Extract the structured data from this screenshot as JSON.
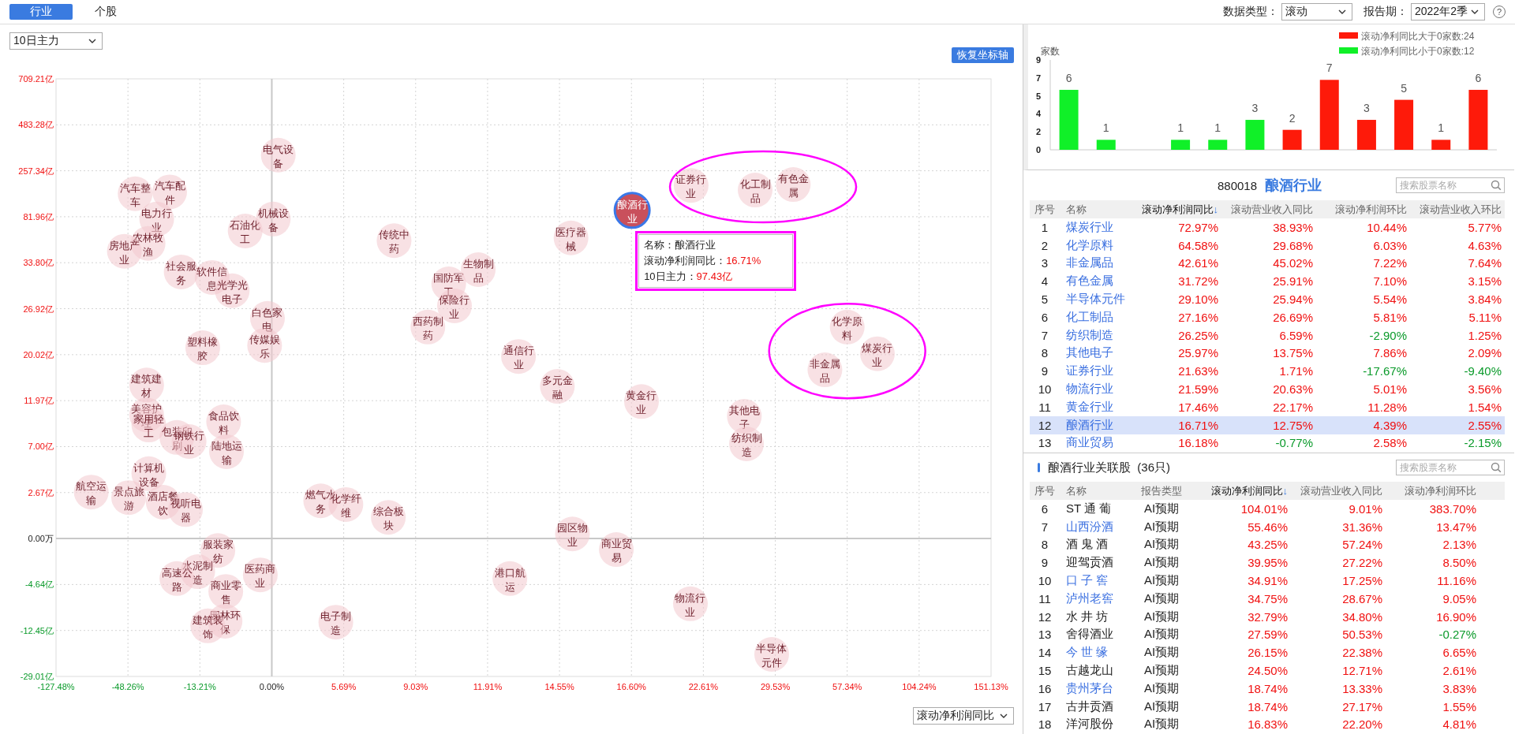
{
  "top_bar": {
    "tabs": [
      {
        "label": "行业",
        "selected": true
      },
      {
        "label": "个股",
        "selected": false
      }
    ],
    "filters": [
      {
        "label": "数据类型：",
        "value": "滚动"
      },
      {
        "label": "报告期：",
        "value": "2022年2季"
      }
    ],
    "help": "?"
  },
  "scatter": {
    "metric_select": "10日主力",
    "reset_button": "恢复坐标轴",
    "axis_select": "滚动净利润同比",
    "x_tick_labels": [
      "-127.48%",
      "-48.26%",
      "-13.21%",
      "0.00%",
      "5.69%",
      "9.03%",
      "11.91%",
      "14.55%",
      "16.60%",
      "22.61%",
      "29.53%",
      "57.34%",
      "104.24%",
      "151.13%"
    ],
    "y_tick_labels": [
      "709.21亿",
      "483.28亿",
      "257.34亿",
      "81.96亿",
      "33.80亿",
      "26.92亿",
      "20.02亿",
      "11.97亿",
      "7.00亿",
      "2.67亿",
      "0.00万",
      "-4.64亿",
      "-12.45亿",
      "-29.01亿"
    ],
    "bubbles": [
      {
        "label": "电气设备",
        "selected": false
      },
      {
        "label": "汽车整车",
        "selected": false
      },
      {
        "label": "汽车配件",
        "selected": false
      },
      {
        "label": "电力行业",
        "selected": false
      },
      {
        "label": "农林牧渔",
        "selected": false
      },
      {
        "label": "房地产业",
        "selected": false
      },
      {
        "label": "石油化工",
        "selected": false
      },
      {
        "label": "机械设备",
        "selected": false
      },
      {
        "label": "传统中药",
        "selected": false
      },
      {
        "label": "社会服务",
        "selected": false
      },
      {
        "label": "软件信息",
        "selected": false
      },
      {
        "label": "光学光电子",
        "selected": false
      },
      {
        "label": "白色家电",
        "selected": false
      },
      {
        "label": "塑料橡胶",
        "selected": false
      },
      {
        "label": "传媒娱乐",
        "selected": false
      },
      {
        "label": "国防军工",
        "selected": false
      },
      {
        "label": "生物制品",
        "selected": false
      },
      {
        "label": "保险行业",
        "selected": false
      },
      {
        "label": "西药制药",
        "selected": false
      },
      {
        "label": "通信行业",
        "selected": false
      },
      {
        "label": "建筑建材",
        "selected": false
      },
      {
        "label": "美容护理",
        "selected": false
      },
      {
        "label": "家用轻工",
        "selected": false
      },
      {
        "label": "包装印刷",
        "selected": false
      },
      {
        "label": "钢铁行业",
        "selected": false
      },
      {
        "label": "食品饮料",
        "selected": false
      },
      {
        "label": "陆地运输",
        "selected": false
      },
      {
        "label": "计算机设备",
        "selected": false
      },
      {
        "label": "航空运输",
        "selected": false
      },
      {
        "label": "景点旅游",
        "selected": false
      },
      {
        "label": "酒店餐饮",
        "selected": false
      },
      {
        "label": "视听电器",
        "selected": false
      },
      {
        "label": "燃气水务",
        "selected": false
      },
      {
        "label": "化学纤维",
        "selected": false
      },
      {
        "label": "综合板块",
        "selected": false
      },
      {
        "label": "服装家纺",
        "selected": false
      },
      {
        "label": "水泥制造",
        "selected": false
      },
      {
        "label": "高速公路",
        "selected": false
      },
      {
        "label": "医药商业",
        "selected": false
      },
      {
        "label": "商业零售",
        "selected": false
      },
      {
        "label": "园林环保",
        "selected": false
      },
      {
        "label": "建筑装饰",
        "selected": false
      },
      {
        "label": "电子制造",
        "selected": false
      },
      {
        "label": "港口航运",
        "selected": false
      },
      {
        "label": "证券行业",
        "selected": false
      },
      {
        "label": "化工制品",
        "selected": false
      },
      {
        "label": "有色金属",
        "selected": false
      },
      {
        "label": "酿酒行业",
        "selected": true
      },
      {
        "label": "医疗器械",
        "selected": false
      },
      {
        "label": "化学原料",
        "selected": false
      },
      {
        "label": "煤炭行业",
        "selected": false
      },
      {
        "label": "非金属品",
        "selected": false
      },
      {
        "label": "多元金融",
        "selected": false
      },
      {
        "label": "黄金行业",
        "selected": false
      },
      {
        "label": "其他电子",
        "selected": false
      },
      {
        "label": "纺织制造",
        "selected": false
      },
      {
        "label": "园区物业",
        "selected": false
      },
      {
        "label": "商业贸易",
        "selected": false
      },
      {
        "label": "物流行业",
        "selected": false
      },
      {
        "label": "半导体元件",
        "selected": false
      }
    ],
    "tooltip": {
      "rows": [
        {
          "label": "名称：",
          "value": "酿酒行业",
          "kind": "plain"
        },
        {
          "label": "滚动净利润同比：",
          "value": "16.71%",
          "kind": "up"
        },
        {
          "label": "10日主力：",
          "value": "97.43亿",
          "kind": "up"
        }
      ]
    }
  },
  "count_chart": {
    "legend": [
      {
        "label": "滚动净利同比大于0家数:24",
        "color": "#fe1a0a"
      },
      {
        "label": "滚动净利同比小于0家数:12",
        "color": "#10f028"
      }
    ],
    "axis_title": "家数",
    "y_axis_labels": [
      "9",
      "7",
      "5",
      "4",
      "2",
      "0"
    ],
    "bars": [
      {
        "kind": "bar",
        "label": "6",
        "level": 0.667,
        "color": "#10f028"
      },
      {
        "kind": "bar",
        "label": "1",
        "level": 0.111,
        "color": "#10f028"
      },
      {
        "kind": "gap"
      },
      {
        "kind": "bar",
        "label": "1",
        "level": 0.111,
        "color": "#10f028"
      },
      {
        "kind": "bar",
        "label": "1",
        "level": 0.111,
        "color": "#10f028"
      },
      {
        "kind": "bar",
        "label": "3",
        "level": 0.333,
        "color": "#10f028"
      },
      {
        "kind": "bar",
        "label": "2",
        "level": 0.222,
        "color": "#fe1a0a"
      },
      {
        "kind": "bar",
        "label": "7",
        "level": 0.778,
        "color": "#fe1a0a"
      },
      {
        "kind": "bar",
        "label": "3",
        "level": 0.333,
        "color": "#fe1a0a"
      },
      {
        "kind": "bar",
        "label": "5",
        "level": 0.556,
        "color": "#fe1a0a"
      },
      {
        "kind": "bar",
        "label": "1",
        "level": 0.111,
        "color": "#fe1a0a"
      },
      {
        "kind": "bar",
        "label": "6",
        "level": 0.667,
        "color": "#fe1a0a"
      }
    ]
  },
  "industry_table": {
    "code": "880018",
    "title": "酿酒行业",
    "search_placeholder": "搜索股票名称",
    "columns": [
      {
        "label": "序号"
      },
      {
        "label": "名称"
      },
      {
        "label": "滚动净利润同比",
        "sort": "↓"
      },
      {
        "label": "滚动营业收入同比"
      },
      {
        "label": "滚动净利润环比"
      },
      {
        "label": "滚动营业收入环比"
      }
    ],
    "rows": [
      {
        "cells": [
          "1",
          "煤炭行业",
          "72.97%",
          "38.93%",
          "10.44%",
          "5.77%"
        ],
        "selected": false
      },
      {
        "cells": [
          "2",
          "化学原料",
          "64.58%",
          "29.68%",
          "6.03%",
          "4.63%"
        ],
        "selected": false
      },
      {
        "cells": [
          "3",
          "非金属品",
          "42.61%",
          "45.02%",
          "7.22%",
          "7.64%"
        ],
        "selected": false
      },
      {
        "cells": [
          "4",
          "有色金属",
          "31.72%",
          "25.91%",
          "7.10%",
          "3.15%"
        ],
        "selected": false
      },
      {
        "cells": [
          "5",
          "半导体元件",
          "29.10%",
          "25.94%",
          "5.54%",
          "3.84%"
        ],
        "selected": false
      },
      {
        "cells": [
          "6",
          "化工制品",
          "27.16%",
          "26.69%",
          "5.81%",
          "5.11%"
        ],
        "selected": false
      },
      {
        "cells": [
          "7",
          "纺织制造",
          "26.25%",
          "6.59%",
          "-2.90%",
          "1.25%"
        ],
        "selected": false
      },
      {
        "cells": [
          "8",
          "其他电子",
          "25.97%",
          "13.75%",
          "7.86%",
          "2.09%"
        ],
        "selected": false
      },
      {
        "cells": [
          "9",
          "证券行业",
          "21.63%",
          "1.71%",
          "-17.67%",
          "-9.40%"
        ],
        "selected": false
      },
      {
        "cells": [
          "10",
          "物流行业",
          "21.59%",
          "20.63%",
          "5.01%",
          "3.56%"
        ],
        "selected": false
      },
      {
        "cells": [
          "11",
          "黄金行业",
          "17.46%",
          "22.17%",
          "11.28%",
          "1.54%"
        ],
        "selected": false
      },
      {
        "cells": [
          "12",
          "酿酒行业",
          "16.71%",
          "12.75%",
          "4.39%",
          "2.55%"
        ],
        "selected": true
      },
      {
        "cells": [
          "13",
          "商业贸易",
          "16.18%",
          "-0.77%",
          "2.58%",
          "-2.15%"
        ],
        "selected": false
      }
    ]
  },
  "stock_table": {
    "title": "酿酒行业关联股  (36只)",
    "search_placeholder": "搜索股票名称",
    "columns": [
      {
        "label": "序号"
      },
      {
        "label": "名称"
      },
      {
        "label": "报告类型"
      },
      {
        "label": "滚动净利润同比",
        "sort": "↓"
      },
      {
        "label": "滚动营业收入同比"
      },
      {
        "label": "滚动净利润环比"
      }
    ],
    "rows": [
      {
        "cells": [
          "6",
          "ST 通 葡",
          "AI预期",
          "104.01%",
          "9.01%",
          "383.70%"
        ],
        "linked": false
      },
      {
        "cells": [
          "7",
          "山西汾酒",
          "AI预期",
          "55.46%",
          "31.36%",
          "13.47%"
        ],
        "linked": true
      },
      {
        "cells": [
          "8",
          "酒 鬼 酒",
          "AI预期",
          "43.25%",
          "57.24%",
          "2.13%"
        ],
        "linked": false
      },
      {
        "cells": [
          "9",
          "迎驾贡酒",
          "AI预期",
          "39.95%",
          "27.22%",
          "8.50%"
        ],
        "linked": false
      },
      {
        "cells": [
          "10",
          "口 子 窖",
          "AI预期",
          "34.91%",
          "17.25%",
          "11.16%"
        ],
        "linked": true
      },
      {
        "cells": [
          "11",
          "泸州老窖",
          "AI预期",
          "34.75%",
          "28.67%",
          "9.05%"
        ],
        "linked": true
      },
      {
        "cells": [
          "12",
          "水 井 坊",
          "AI预期",
          "32.79%",
          "34.80%",
          "16.90%"
        ],
        "linked": false
      },
      {
        "cells": [
          "13",
          "舍得酒业",
          "AI预期",
          "27.59%",
          "50.53%",
          "-0.27%"
        ],
        "linked": false
      },
      {
        "cells": [
          "14",
          "今 世 缘",
          "AI预期",
          "26.15%",
          "22.38%",
          "6.65%"
        ],
        "linked": true
      },
      {
        "cells": [
          "15",
          "古越龙山",
          "AI预期",
          "24.50%",
          "12.71%",
          "2.61%"
        ],
        "linked": false
      },
      {
        "cells": [
          "16",
          "贵州茅台",
          "AI预期",
          "18.74%",
          "13.33%",
          "3.83%"
        ],
        "linked": true
      },
      {
        "cells": [
          "17",
          "古井贡酒",
          "AI预期",
          "18.74%",
          "27.17%",
          "1.55%"
        ],
        "linked": false
      },
      {
        "cells": [
          "18",
          "洋河股份",
          "AI预期",
          "16.83%",
          "22.20%",
          "4.81%"
        ],
        "linked": false
      }
    ]
  }
}
